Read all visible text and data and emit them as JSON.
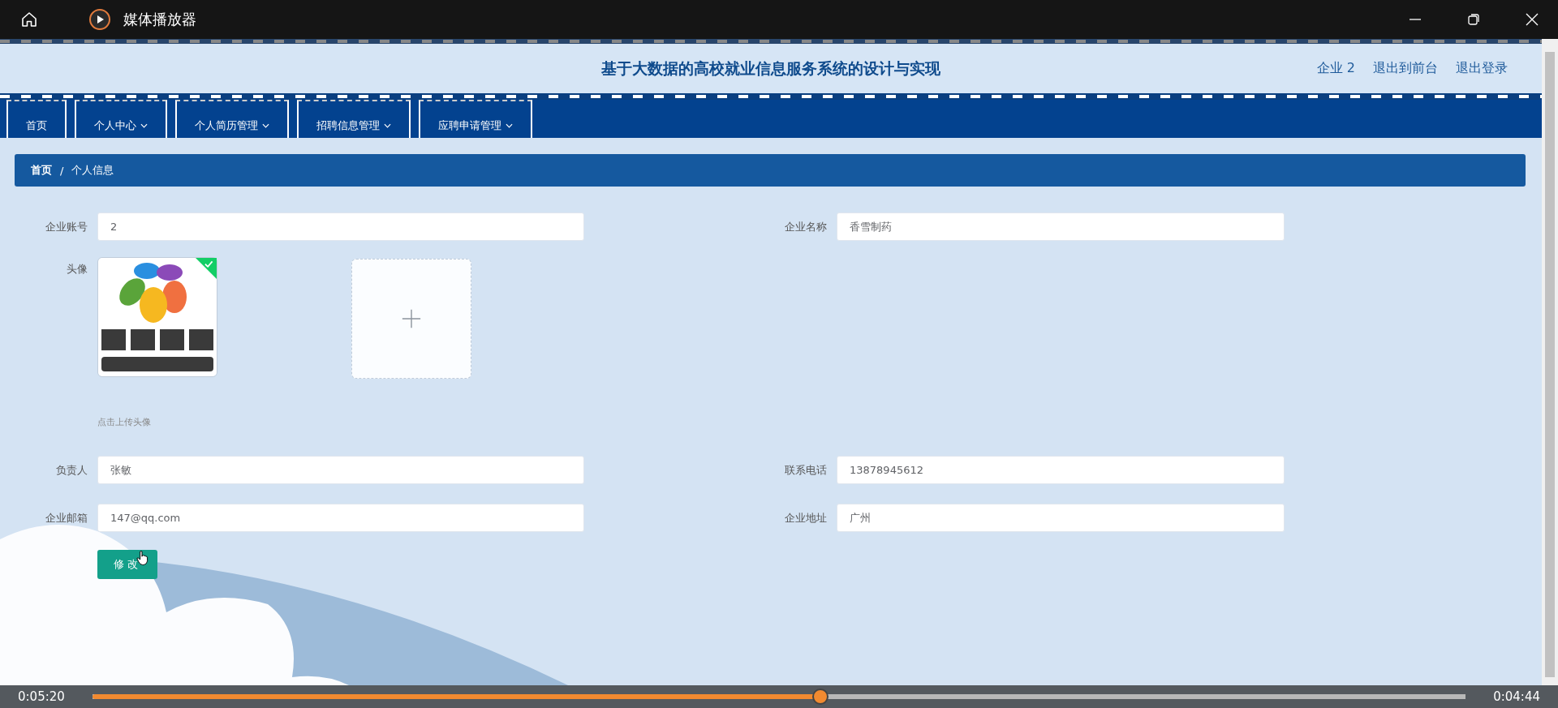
{
  "player": {
    "title": "媒体播放器",
    "elapsed": "0:05:20",
    "remaining": "0:04:44",
    "level": 0.53
  },
  "header": {
    "title": "基于大数据的高校就业信息服务系统的设计与实现",
    "user": "企业 2",
    "links": [
      "退出到前台",
      "退出登录"
    ]
  },
  "nav": [
    {
      "label": "首页",
      "dropdown": false
    },
    {
      "label": "个人中心",
      "dropdown": true
    },
    {
      "label": "个人简历管理",
      "dropdown": true
    },
    {
      "label": "招聘信息管理",
      "dropdown": true
    },
    {
      "label": "应聘申请管理",
      "dropdown": true
    }
  ],
  "breadcrumb": {
    "items": [
      "首页",
      "个人信息"
    ],
    "separator": "/"
  },
  "form": {
    "fields_top": [
      {
        "label": "企业账号",
        "value": "2"
      },
      {
        "label": "企业名称",
        "value": "香雪制药"
      }
    ],
    "avatar": {
      "label": "头像",
      "uploaded": true,
      "hint": "点击上传头像"
    },
    "fields_bottom": [
      {
        "label": "负责人",
        "value": "张敏"
      },
      {
        "label": "联系电话",
        "value": "13878945612"
      },
      {
        "label": "企业邮箱",
        "value": "147@qq.com"
      },
      {
        "label": "企业地址",
        "value": "广州"
      }
    ],
    "submit": "修改"
  }
}
